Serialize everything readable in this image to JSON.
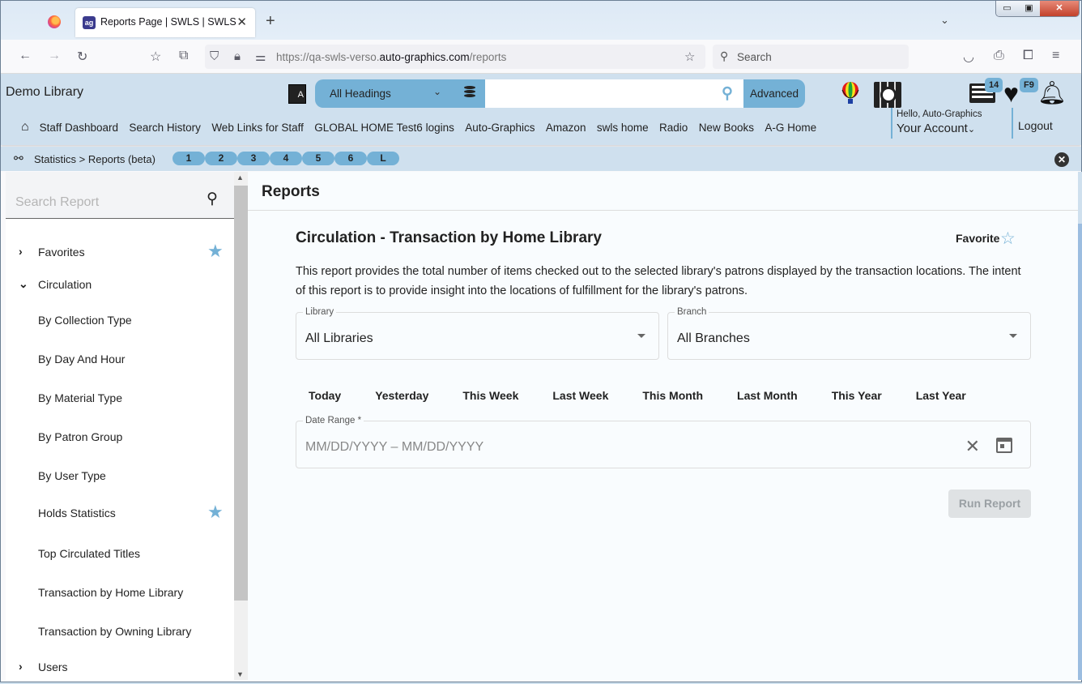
{
  "browser": {
    "tab_title": "Reports Page | SWLS | SWLS | Auto-Graphics",
    "tab_favicon": "ag",
    "url_prefix": "https://qa-swls-verso.",
    "url_domain": "auto-graphics.com",
    "url_path": "/reports",
    "search_placeholder": "Search",
    "window_buttons": {
      "minimize": "▭",
      "maximize": "▣",
      "close": "✕"
    }
  },
  "app": {
    "library_name": "Demo Library",
    "search": {
      "scope": "All Headings",
      "value": "",
      "advanced_label": "Advanced"
    },
    "badges": {
      "list_count": "14",
      "favorites_key": "F9"
    },
    "account": {
      "greeting": "Hello, Auto-Graphics",
      "label": "Your Account",
      "logout": "Logout"
    },
    "links": [
      "Staff Dashboard",
      "Search History",
      "Web Links for Staff",
      "GLOBAL HOME Test6 logins",
      "Auto-Graphics",
      "Amazon",
      "swls home",
      "Radio",
      "New Books",
      "A-G Home"
    ]
  },
  "breadcrumb": {
    "path": "Statistics > Reports (beta)",
    "pills": [
      "1",
      "2",
      "3",
      "4",
      "5",
      "6",
      "L"
    ]
  },
  "sidebar": {
    "search_placeholder": "Search Report",
    "items": [
      {
        "label": "Favorites",
        "type": "group",
        "expanded": false,
        "starred": true
      },
      {
        "label": "Circulation",
        "type": "group",
        "expanded": true,
        "starred": false
      },
      {
        "label": "By Collection Type",
        "type": "report",
        "starred": false
      },
      {
        "label": "By Day And Hour",
        "type": "report",
        "starred": false
      },
      {
        "label": "By Material Type",
        "type": "report",
        "starred": false
      },
      {
        "label": "By Patron Group",
        "type": "report",
        "starred": false
      },
      {
        "label": "By User Type",
        "type": "report",
        "starred": false
      },
      {
        "label": "Holds Statistics",
        "type": "report",
        "starred": true
      },
      {
        "label": "Top Circulated Titles",
        "type": "report",
        "starred": false
      },
      {
        "label": "Transaction by Home Library",
        "type": "report",
        "starred": false
      },
      {
        "label": "Transaction by Owning Library",
        "type": "report",
        "starred": false
      },
      {
        "label": "Users",
        "type": "group",
        "expanded": false,
        "starred": false
      }
    ]
  },
  "main": {
    "header": "Reports",
    "report_title": "Circulation - Transaction by Home Library",
    "favorite_label": "Favorite",
    "favorite_on": false,
    "description": "This report provides the total number of items checked out to the selected library's patrons displayed by the transaction locations. The intent of this report is to provide insight into the locations of fulfillment for the library's patrons.",
    "library": {
      "label": "Library",
      "value": "All Libraries"
    },
    "branch": {
      "label": "Branch",
      "value": "All Branches"
    },
    "presets": [
      "Today",
      "Yesterday",
      "This Week",
      "Last Week",
      "This Month",
      "Last Month",
      "This Year",
      "Last Year"
    ],
    "date_range": {
      "label": "Date Range *",
      "placeholder": "MM/DD/YYYY – MM/DD/YYYY",
      "value": ""
    },
    "run_label": "Run Report",
    "run_enabled": false
  },
  "colors": {
    "accent": "#74b1d6",
    "header_bg": "#cfe0ee"
  }
}
